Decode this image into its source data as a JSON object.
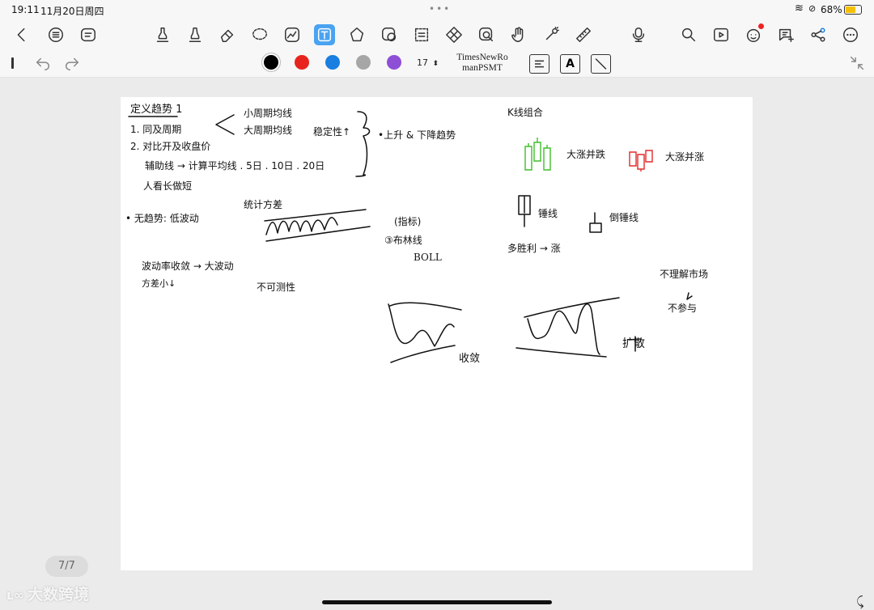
{
  "status": {
    "time": "19:11",
    "date": "11月20日周四",
    "battery": "68%"
  },
  "toolbar": {
    "font_size": "17",
    "font_name_line1": "TimesNewRo",
    "font_name_line2": "manPSMT",
    "text_style_label": "A"
  },
  "colors": [
    "#000000",
    "#e8231d",
    "#1a7fe0",
    "#a6a6a6",
    "#8e4fd6"
  ],
  "page_indicator": "7/7",
  "watermark": "大数跨境",
  "note": {
    "t1": "定义趋势 1",
    "t2": "1. 同及周期",
    "t3": "2. 对比开及收盘价",
    "t4": "辅助线 → 计算平均线 . 5日 . 10日 . 20日",
    "t5": "人看长做短",
    "t6": "小周期均线",
    "t7": "大周期均线",
    "t8": "稳定性↑",
    "t9": "•上升 & 下降趋势",
    "t10": "统计方差",
    "t11": "• 无趋势: 低波动",
    "t12": "(指标)",
    "t13": "③布林线",
    "t14": "BOLL",
    "t15": "波动率收敛 → 大波动",
    "t16": "方差小↓",
    "t17": "不可测性",
    "t18": "K线组合",
    "t19": "大涨并跌",
    "t20": "大涨并涨",
    "t21": "锤线",
    "t22": "倒锤线",
    "t23": "多胜利 → 涨",
    "t24": "不理解市场",
    "t25": "不参与",
    "t26": "收敛",
    "t27": "扩散"
  }
}
